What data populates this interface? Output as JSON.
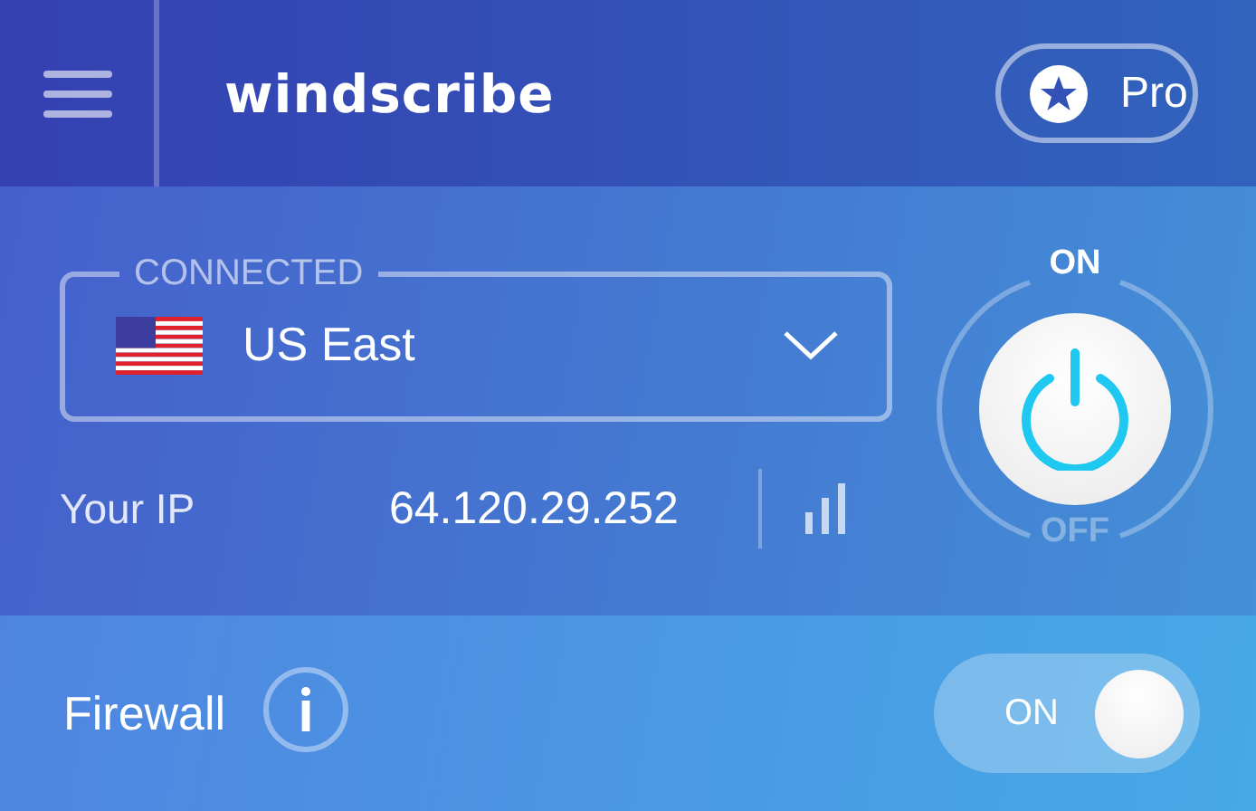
{
  "header": {
    "logo": "windscribe",
    "pro_button": {
      "label": "Pro"
    }
  },
  "connection": {
    "status": "CONNECTED",
    "location": "US East",
    "ip_label": "Your IP",
    "ip": "64.120.29.252"
  },
  "power": {
    "on": true,
    "on_label": "ON",
    "off_label": "OFF"
  },
  "firewall": {
    "label": "Firewall",
    "on": true,
    "toggle_label": "ON"
  }
}
